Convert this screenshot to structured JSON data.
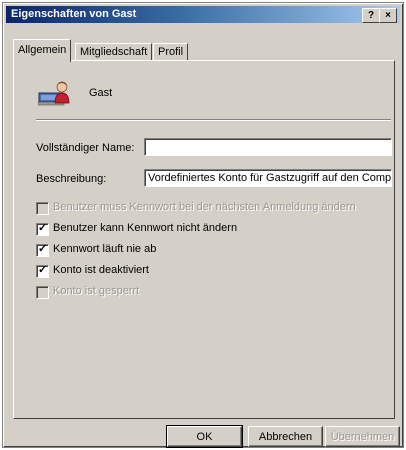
{
  "window": {
    "title": "Eigenschaften von Gast",
    "help_glyph": "?",
    "close_glyph": "×"
  },
  "tabs": [
    {
      "label": "Allgemein",
      "active": true
    },
    {
      "label": "Mitgliedschaft",
      "active": false
    },
    {
      "label": "Profil",
      "active": false
    }
  ],
  "user": {
    "name": "Gast",
    "icon": "user-account-icon"
  },
  "fields": {
    "full_name": {
      "label": "Vollständiger Name:",
      "value": ""
    },
    "description": {
      "label": "Beschreibung:",
      "value": "Vordefiniertes Konto für Gastzugriff auf den Computer"
    }
  },
  "checkboxes": [
    {
      "label": "Benutzer muss Kennwort bei der nächsten Anmeldung ändern",
      "checked": false,
      "enabled": false
    },
    {
      "label": "Benutzer kann Kennwort nicht ändern",
      "checked": true,
      "enabled": true
    },
    {
      "label": "Kennwort läuft nie ab",
      "checked": true,
      "enabled": true
    },
    {
      "label": "Konto ist deaktiviert",
      "checked": true,
      "enabled": true
    },
    {
      "label": "Konto ist gesperrt",
      "checked": false,
      "enabled": false
    }
  ],
  "buttons": {
    "ok": "OK",
    "cancel": "Abbrechen",
    "apply": "Übernehmen"
  },
  "colors": {
    "titlebar_start": "#0a246a",
    "titlebar_end": "#a6caf0",
    "face": "#d4d0c8"
  }
}
